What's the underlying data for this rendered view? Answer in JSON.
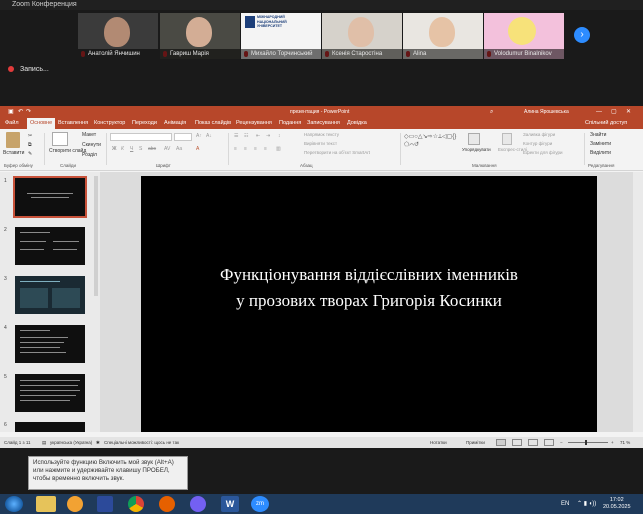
{
  "zoom": {
    "title": "Zoom Конференция",
    "participants": [
      {
        "name": "Анатолій Янчишин"
      },
      {
        "name": "Гавриш Марія"
      },
      {
        "name": "Михайло Торчинський"
      },
      {
        "name": "Ксенія Старостіна"
      },
      {
        "name": "Alina"
      },
      {
        "name": "Volodumur Binalnikov"
      }
    ],
    "uni_logo_text": "МІЖНАРОДНИЙ НАЦІОНАЛЬНИЙ УНІВЕРСИТЕТ",
    "recording_label": "Запись..."
  },
  "ppt": {
    "title": "презентация - PowerPoint",
    "user": "Алина Ярошевська",
    "tabs": [
      "Файл",
      "Основне",
      "Вставлення",
      "Конструктор",
      "Переходи",
      "Анімація",
      "Показ слайдів",
      "Рецензування",
      "Подання",
      "Записування",
      "Довідка"
    ],
    "share": "Спільний доступ",
    "ribbon": {
      "paste": "Вставити",
      "create_slide": "Створити слайд",
      "layout": "Макет",
      "reset": "Скинути",
      "section": "Розділ",
      "text_direction": "Напрямок тексту",
      "align_text": "Вирівняти текст",
      "smartart": "Перетворити на обʼєкт SmartArt",
      "arrange": "Упорядкувати",
      "quick_styles": "Експрес-стилі",
      "shape_fill": "Заливка фігури",
      "shape_outline": "Контур фігури",
      "shape_effects": "Ефекти для фігури",
      "find": "Знайти",
      "replace": "Замінити",
      "select": "Виділити",
      "groups": [
        "Буфер обміну",
        "Слайди",
        "Шрифт",
        "Абзац",
        "Малювання",
        "Редагування"
      ]
    },
    "slide_numbers": [
      "1",
      "2",
      "3",
      "4",
      "5",
      "6"
    ],
    "slide_title_line1": "Функціонування віддієслівних іменників",
    "slide_title_line2": "у прозових творах Григорія Косинки",
    "status": {
      "slide_of": "Слайд 1 з 11",
      "language": "українська (Україна)",
      "accessibility": "Спеціальні можливості: щось не так",
      "notes": "Нотатки",
      "comments": "Примітки",
      "zoom": "71 %"
    }
  },
  "tooltip": "Используйте функцию Включить мой звук (Alt+A) или нажмите и удерживайте клавишу ПРОБЕЛ, чтобы временно включить звук.",
  "taskbar": {
    "lang": "EN",
    "time": "17:02",
    "date": "20.05.2025",
    "zoom_icon_label": "zm"
  },
  "colors": {
    "ppt_accent": "#b7472a",
    "zoom_blue": "#2d8cff",
    "taskbar": "#1f3a5a"
  }
}
